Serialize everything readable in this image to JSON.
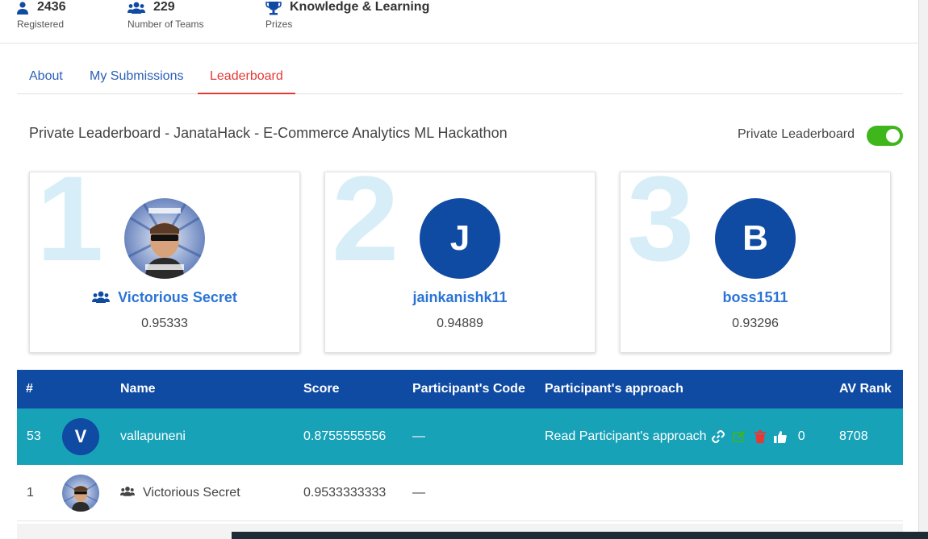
{
  "stats": [
    {
      "icon": "user-icon",
      "value": "2436",
      "label": "Registered"
    },
    {
      "icon": "users-icon",
      "value": "229",
      "label": "Number of Teams"
    },
    {
      "icon": "trophy-icon",
      "value": "Knowledge & Learning",
      "label": "Prizes"
    }
  ],
  "tabs": [
    {
      "label": "About",
      "active": false
    },
    {
      "label": "My Submissions",
      "active": false
    },
    {
      "label": "Leaderboard",
      "active": true
    }
  ],
  "leaderboard": {
    "title": "Private Leaderboard - JanataHack - E-Commerce Analytics ML Hackathon",
    "toggle_label": "Private Leaderboard",
    "toggle_on": true
  },
  "podium": [
    {
      "rank": "1",
      "name": "Victorious Secret",
      "score": "0.95333",
      "avatar": "photo",
      "team": true
    },
    {
      "rank": "2",
      "name": "jainkanishk11",
      "score": "0.94889",
      "avatar_letter": "J"
    },
    {
      "rank": "3",
      "name": "boss1511",
      "score": "0.93296",
      "avatar_letter": "B"
    }
  ],
  "table": {
    "headers": {
      "rank": "#",
      "name": "Name",
      "score": "Score",
      "code": "Participant's Code",
      "approach": "Participant's approach",
      "av_rank": "AV Rank"
    },
    "rows": [
      {
        "rank": "53",
        "avatar_letter": "V",
        "name": "vallapuneni",
        "score": "0.8755555556",
        "code": "—",
        "approach": "Read Participant's approach",
        "likes": "0",
        "av_rank": "8708"
      },
      {
        "rank": "1",
        "name": "Victorious Secret",
        "score": "0.9533333333",
        "code": "—"
      }
    ]
  },
  "colors": {
    "primary": "#0f4aa3",
    "highlight_row": "#18a2b8",
    "active_tab": "#e53935",
    "link": "#2b74d6",
    "toggle": "#3fb61c"
  }
}
